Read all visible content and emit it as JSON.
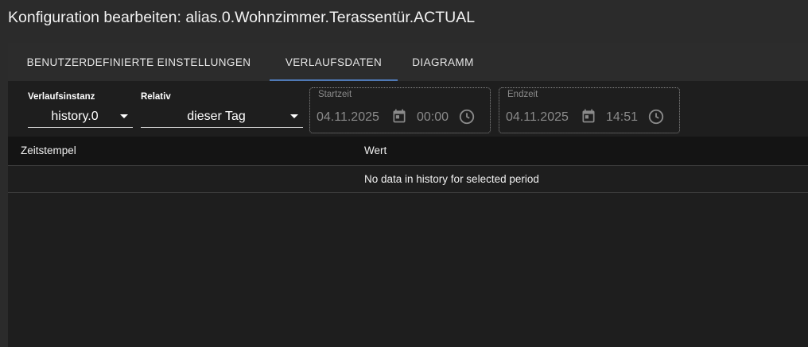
{
  "dialog": {
    "title": "Konfiguration bearbeiten: alias.0.Wohnzimmer.Terassentür.ACTUAL"
  },
  "tabs": [
    {
      "label": "BENUTZERDEFINIERTE EINSTELLUNGEN",
      "active": false
    },
    {
      "label": "VERLAUFSDATEN",
      "active": true
    },
    {
      "label": "DIAGRAMM",
      "active": false
    }
  ],
  "filters": {
    "instance": {
      "label": "Verlaufsinstanz",
      "value": "history.0"
    },
    "relative": {
      "label": "Relativ",
      "value": "dieser Tag"
    },
    "start": {
      "label": "Startzeit",
      "date": "04.11.2025",
      "time": "00:00"
    },
    "end": {
      "label": "Endzeit",
      "date": "04.11.2025",
      "time": "14:51"
    }
  },
  "table": {
    "columns": [
      "Zeitstempel",
      "Wert"
    ],
    "empty_message": "No data in history for selected period"
  },
  "colors": {
    "accent": "#4f79b6",
    "background": "#1e1e1e",
    "header": "#2b2b2b"
  },
  "icons": {
    "calendar": "calendar-icon",
    "clock": "clock-icon",
    "dropdown": "chevron-down-icon"
  }
}
